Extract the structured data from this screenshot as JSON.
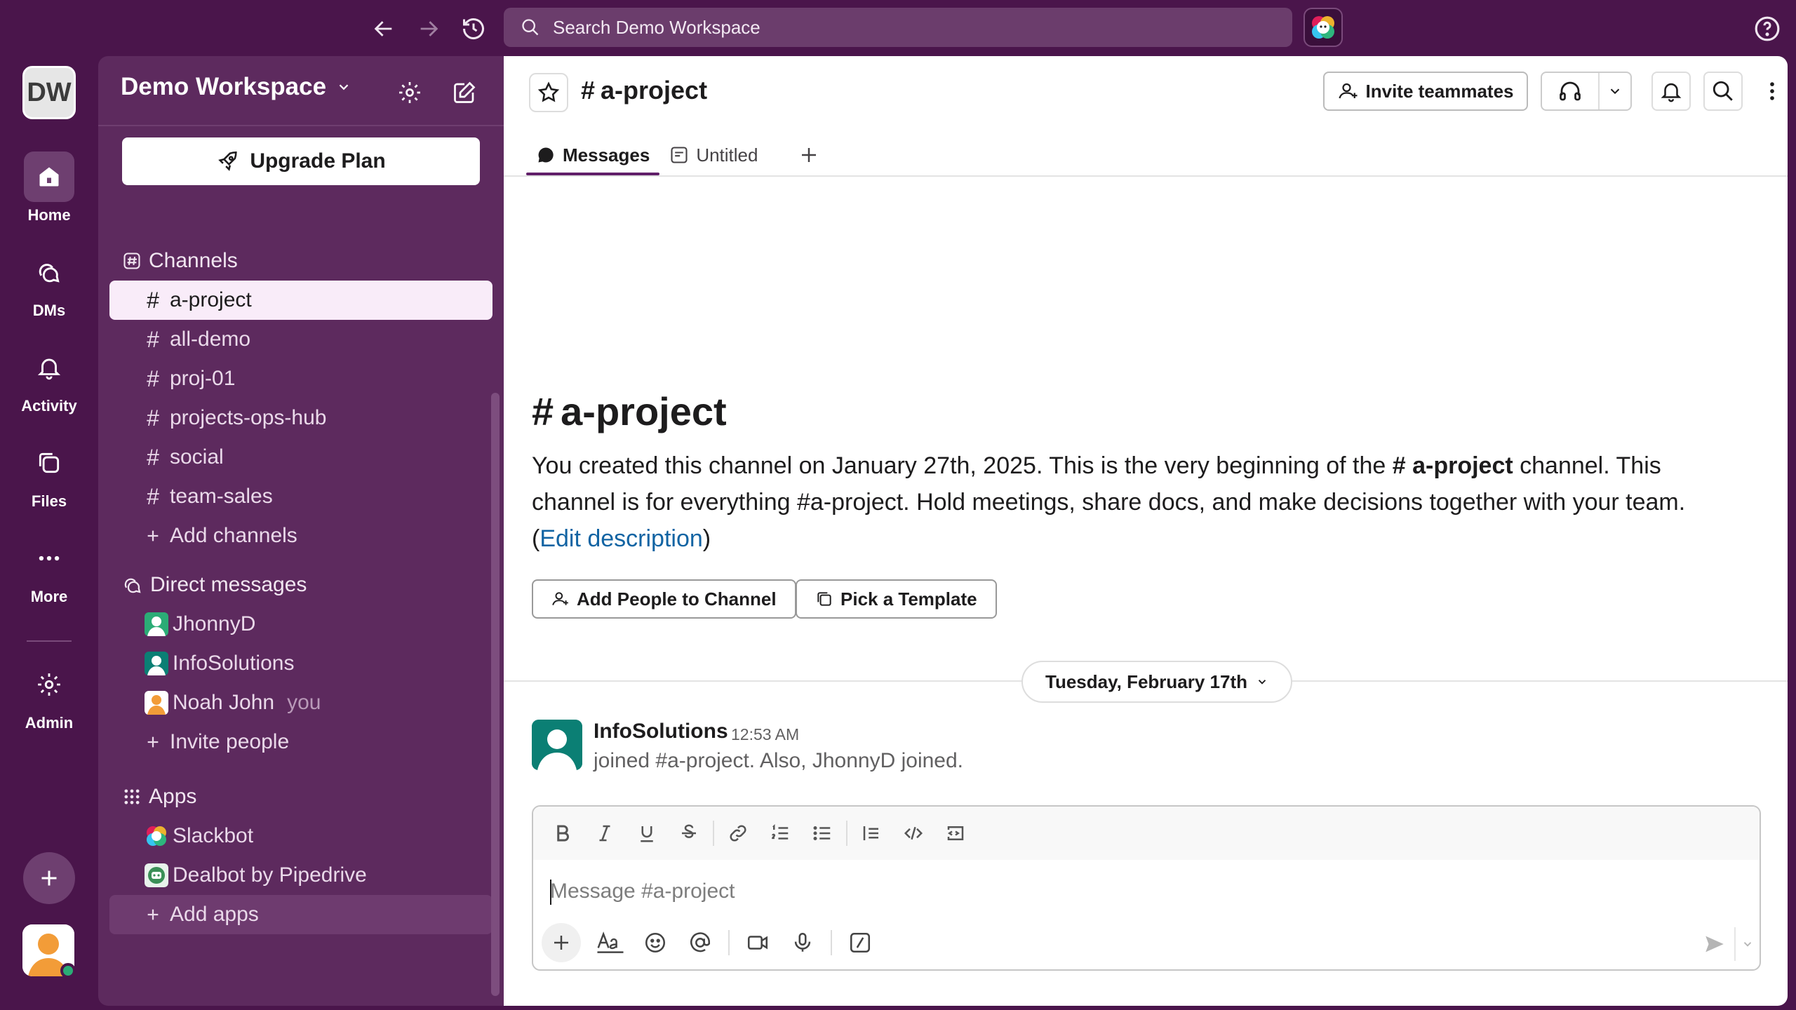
{
  "topbar": {
    "search_placeholder": "Search Demo Workspace",
    "back_icon": "arrow-left-icon",
    "forward_icon": "arrow-right-icon",
    "history_icon": "history-icon",
    "help_icon": "help-icon"
  },
  "rail": {
    "workspace_initials": "DW",
    "items": [
      {
        "label": "Home",
        "icon": "home-icon"
      },
      {
        "label": "DMs",
        "icon": "dm-icon"
      },
      {
        "label": "Activity",
        "icon": "bell-icon"
      },
      {
        "label": "Files",
        "icon": "files-icon"
      },
      {
        "label": "More",
        "icon": "more-icon"
      },
      {
        "label": "Admin",
        "icon": "gear-icon"
      }
    ]
  },
  "sidebar": {
    "workspace_name": "Demo Workspace",
    "upgrade_label": "Upgrade Plan",
    "channels_header": "Channels",
    "channels": [
      {
        "name": "a-project",
        "active": true
      },
      {
        "name": "all-demo"
      },
      {
        "name": "proj-01"
      },
      {
        "name": "projects-ops-hub"
      },
      {
        "name": "social"
      },
      {
        "name": "team-sales"
      }
    ],
    "add_channels_label": "Add channels",
    "dms_header": "Direct messages",
    "dms": [
      {
        "name": "JhonnyD"
      },
      {
        "name": "InfoSolutions"
      },
      {
        "name": "Noah John",
        "suffix": "you"
      }
    ],
    "invite_label": "Invite people",
    "apps_header": "Apps",
    "apps": [
      {
        "name": "Slackbot"
      },
      {
        "name": "Dealbot by Pipedrive"
      }
    ],
    "add_apps_label": "Add apps"
  },
  "header": {
    "channel_name": "a-project",
    "invite_label": "Invite teammates",
    "tabs": [
      {
        "label": "Messages",
        "active": true
      },
      {
        "label": "Untitled"
      }
    ]
  },
  "intro": {
    "title": "a-project",
    "text_before": "You created this channel on January 27th, 2025. This is the very beginning of the ",
    "channel_bold": "a-project",
    "text_after": " channel. This channel is for everything #a-project. Hold meetings, share docs, and make decisions together with your team.",
    "paren_open": "(",
    "edit_link": "Edit description",
    "paren_close": ")",
    "add_people_label": "Add People to Channel",
    "pick_template_label": "Pick a Template"
  },
  "date_divider": "Tuesday, February 17th",
  "message": {
    "author": "InfoSolutions",
    "time": "12:53 AM",
    "body": "joined #a-project. Also, JhonnyD joined."
  },
  "composer": {
    "placeholder": "Message #a-project"
  },
  "colors": {
    "aubergine": "#4a154b",
    "sidebar": "#5d2a5e",
    "link": "#1264a3",
    "online": "#2bac76"
  }
}
